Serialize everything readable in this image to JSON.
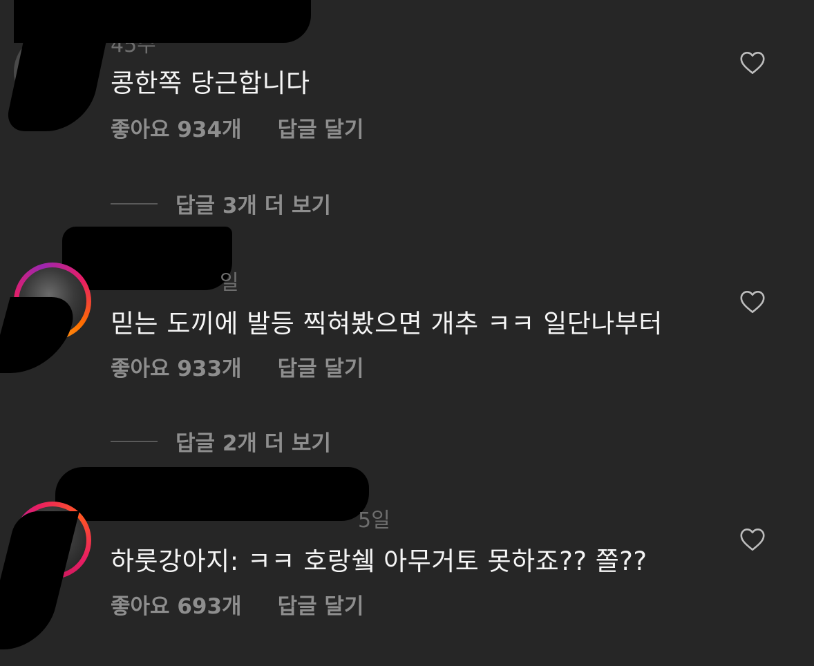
{
  "comments": [
    {
      "meta": "45주",
      "text": "콩한쪽 당근합니다",
      "likes": "좋아요 934개",
      "reply": "답글 달기",
      "view_replies": "답글 3개 더 보기"
    },
    {
      "meta": "일",
      "text": "믿는 도끼에 발등 찍혀봤으면 개추 ㅋㅋ 일단나부터",
      "likes": "좋아요 933개",
      "reply": "답글 달기",
      "view_replies": "답글 2개 더 보기"
    },
    {
      "meta": "5일",
      "text": "하룻강아지: ㅋㅋ 호랑쉨 아무거토 못하죠?? 쫄??",
      "likes": "좋아요 693개",
      "reply": "답글 달기"
    }
  ],
  "icons": {
    "like": "heart-outline-icon"
  },
  "colors": {
    "background": "#262626",
    "primary_text": "#f5f5f5",
    "secondary_text": "#8e8e8e"
  }
}
